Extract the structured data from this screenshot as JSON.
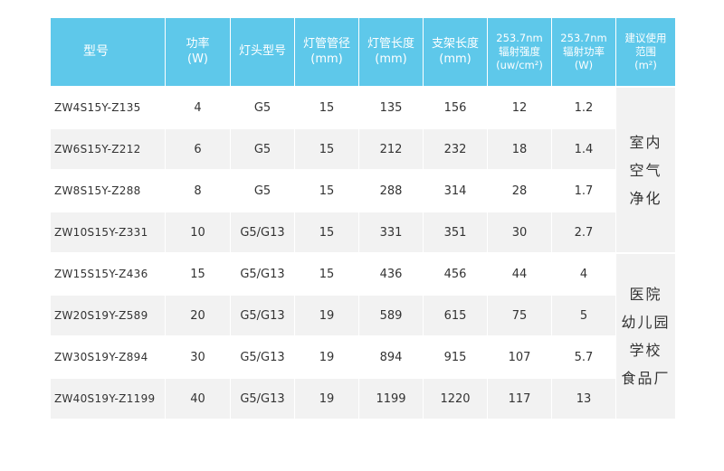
{
  "headers": [
    {
      "lines": [
        "型号"
      ]
    },
    {
      "lines": [
        "功率",
        "(W)"
      ]
    },
    {
      "lines": [
        "灯头型号"
      ]
    },
    {
      "lines": [
        "灯管管径",
        "(mm)"
      ]
    },
    {
      "lines": [
        "灯管长度",
        "(mm)"
      ]
    },
    {
      "lines": [
        "支架长度",
        "(mm)"
      ]
    },
    {
      "lines": [
        "253.7nm",
        "辐射强度",
        "(uw/cm²)"
      ]
    },
    {
      "lines": [
        "253.7nm",
        "辐射功率",
        "(W)"
      ]
    },
    {
      "lines": [
        "建议使用",
        "范围",
        "(m²)"
      ]
    }
  ],
  "rows": [
    {
      "model": "ZW4S15Y-Z135",
      "power": "4",
      "base": "G5",
      "diameter": "15",
      "tube_length": "135",
      "bracket_length": "156",
      "intensity": "12",
      "rad_power": "1.2"
    },
    {
      "model": "ZW6S15Y-Z212",
      "power": "6",
      "base": "G5",
      "diameter": "15",
      "tube_length": "212",
      "bracket_length": "232",
      "intensity": "18",
      "rad_power": "1.4"
    },
    {
      "model": "ZW8S15Y-Z288",
      "power": "8",
      "base": "G5",
      "diameter": "15",
      "tube_length": "288",
      "bracket_length": "314",
      "intensity": "28",
      "rad_power": "1.7"
    },
    {
      "model": "ZW10S15Y-Z331",
      "power": "10",
      "base": "G5/G13",
      "diameter": "15",
      "tube_length": "331",
      "bracket_length": "351",
      "intensity": "30",
      "rad_power": "2.7"
    },
    {
      "model": "ZW15S15Y-Z436",
      "power": "15",
      "base": "G5/G13",
      "diameter": "15",
      "tube_length": "436",
      "bracket_length": "456",
      "intensity": "44",
      "rad_power": "4"
    },
    {
      "model": "ZW20S19Y-Z589",
      "power": "20",
      "base": "G5/G13",
      "diameter": "19",
      "tube_length": "589",
      "bracket_length": "615",
      "intensity": "75",
      "rad_power": "5"
    },
    {
      "model": "ZW30S19Y-Z894",
      "power": "30",
      "base": "G5/G13",
      "diameter": "19",
      "tube_length": "894",
      "bracket_length": "915",
      "intensity": "107",
      "rad_power": "5.7"
    },
    {
      "model": "ZW40S19Y-Z1199",
      "power": "40",
      "base": "G5/G13",
      "diameter": "19",
      "tube_length": "1199",
      "bracket_length": "1220",
      "intensity": "117",
      "rad_power": "13"
    }
  ],
  "usage_groups": [
    {
      "lines": [
        "室内",
        "空气",
        "净化"
      ]
    },
    {
      "lines": [
        "医院",
        "幼儿园",
        "学校",
        "食品厂"
      ]
    }
  ]
}
